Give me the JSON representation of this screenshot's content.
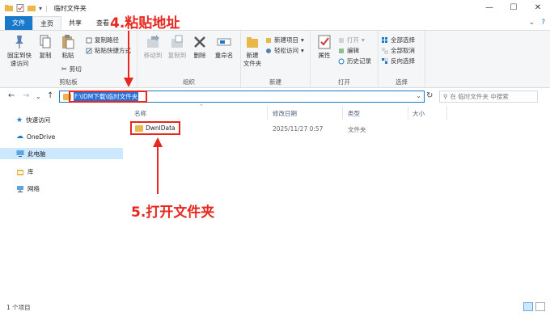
{
  "window": {
    "title": "临时文件夹"
  },
  "tabs": [
    "文件",
    "主页",
    "共享",
    "查看"
  ],
  "ribbon": {
    "clipboard": {
      "pin": "固定到快\n速访问",
      "copy": "复制",
      "paste": "粘贴",
      "copy_path": "复制路径",
      "paste_shortcut": "粘贴快捷方式",
      "cut": "剪切",
      "group": "剪贴板"
    },
    "organize": {
      "move_to": "移动到",
      "copy_to": "复制到",
      "delete": "删除",
      "rename": "重命名",
      "group": "组织"
    },
    "new": {
      "new_folder": "新建\n文件夹",
      "new_item": "新建项目",
      "easy_access": "轻松访问",
      "group": "新建"
    },
    "open": {
      "properties": "属性",
      "open": "打开",
      "edit": "编辑",
      "history": "历史记录",
      "group": "打开"
    },
    "select": {
      "select_all": "全部选择",
      "select_none": "全部取消",
      "invert": "反向选择",
      "group": "选择"
    }
  },
  "address": {
    "path": "F:\\IDM下载\\临时文件夹",
    "search_placeholder": "在 临时文件夹 中搜索"
  },
  "sidebar": [
    "快速访问",
    "OneDrive",
    "此电脑",
    "库",
    "网络"
  ],
  "columns": [
    "名称",
    "修改日期",
    "类型",
    "大小"
  ],
  "files": [
    {
      "name": "DwnlData",
      "date": "2025/11/27 0:57",
      "type": "文件夹",
      "size": ""
    }
  ],
  "annotations": {
    "step4": "4.粘贴地址",
    "step5": "5.打开文件夹"
  },
  "status": {
    "count": "1 个项目"
  },
  "colors": {
    "accent": "#1979ca",
    "annotation": "#e8261d",
    "folder": "#e8b84a"
  }
}
